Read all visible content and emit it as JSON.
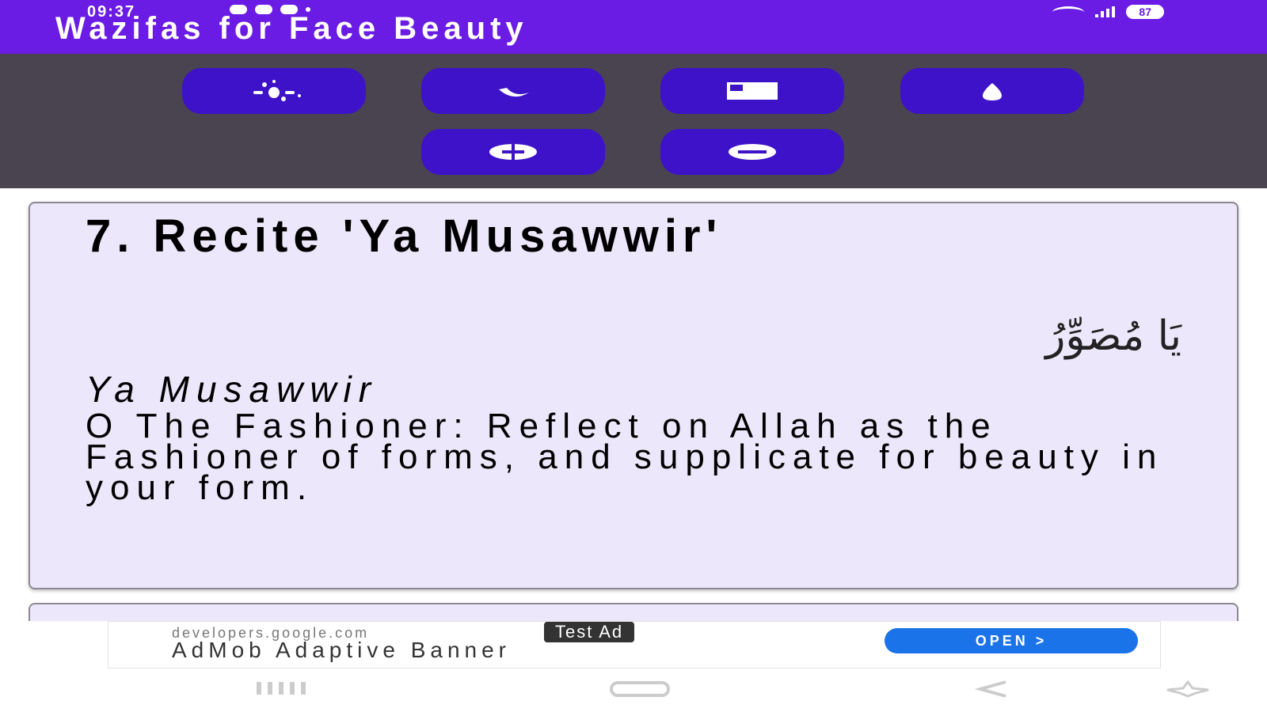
{
  "status_bar": {
    "time": "09:37",
    "battery": "87"
  },
  "app_bar": {
    "title": "Wazifas for Face Beauty"
  },
  "toolbar": {
    "buttons": [
      {
        "icon": "sparkle-icon"
      },
      {
        "icon": "moon-icon"
      },
      {
        "icon": "card-icon"
      },
      {
        "icon": "drop-icon"
      },
      {
        "icon": "plus-icon"
      },
      {
        "icon": "minus-icon"
      }
    ],
    "button_color": "#3d12c8",
    "background": "#4a4451"
  },
  "card": {
    "title": "7. Recite 'Ya Musawwir'",
    "arabic": "يَا مُصَوِّرُ",
    "transliteration": "Ya Musawwir",
    "meaning": "O The Fashioner: Reflect on Allah as the Fashioner of forms, and supplicate for beauty in your form."
  },
  "ad": {
    "url": "developers.google.com",
    "badge": "Test Ad",
    "title": "AdMob Adaptive Banner",
    "cta": "OPEN  >"
  },
  "colors": {
    "appbar": "#6a1be4",
    "card_bg": "#ede7fb",
    "cta": "#1a73e8"
  }
}
